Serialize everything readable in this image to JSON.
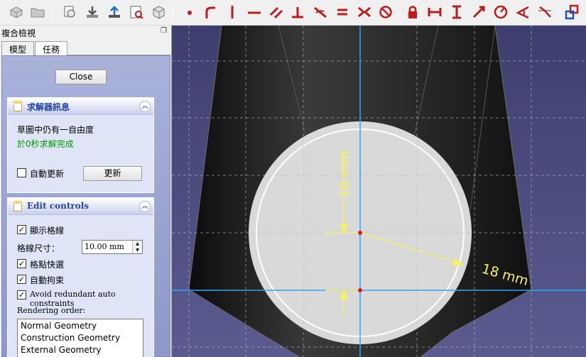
{
  "toolbar": {
    "icons": [
      "part-icon",
      "open-folder-icon",
      "view-sketch-icon",
      "map-sketch-icon",
      "leave-sketch-icon",
      "view-section-icon",
      "stereo-icon",
      "point-icon",
      "polyline-icon",
      "vertical-line-icon",
      "horizontal-line-icon",
      "parallel-icon",
      "perpendicular-icon",
      "tangent-icon",
      "equal-icon",
      "symmetric-icon",
      "block-icon",
      "lock-icon",
      "horizontal-distance-icon",
      "vertical-distance-icon",
      "distance-icon",
      "radius-icon",
      "angle-icon",
      "snell-icon",
      "toggle-constraint-icon"
    ]
  },
  "panel": {
    "title": "複合檢視",
    "tabs": [
      "模型",
      "任務"
    ],
    "active_tab": "任務",
    "close_label": "Close",
    "solver": {
      "title": "求解器訊息",
      "dof_text": "草圖中仍有一自由度",
      "solved_text": "於0秒求解完成",
      "auto_update_label": "自動更新",
      "auto_update_checked": false,
      "update_button": "更新"
    },
    "edit": {
      "title": "Edit controls",
      "show_grid_label": "顯示格線",
      "grid_size_label": "格線尺寸：",
      "grid_size_value": "10.00 mm",
      "grid_snap_label": "格點快選",
      "auto_constraints_label": "自動拘束",
      "avoid_redundant_label": "Avoid redundant auto constraints",
      "rendering_order_label": "Rendering order:",
      "rendering_order": [
        "Normal Geometry",
        "Construction Geometry",
        "External Geometry"
      ]
    }
  },
  "viewport": {
    "dimensions": [
      "10 mm",
      "18 mm"
    ],
    "colors": {
      "background_top": "#3e3e6e",
      "background_bottom": "#5b5b90",
      "body": "#1c1c1c",
      "face": "#d9d9d9",
      "axis": "#2aa6ff",
      "dimension": "#f5f06a",
      "point": "#e01b1b"
    }
  }
}
